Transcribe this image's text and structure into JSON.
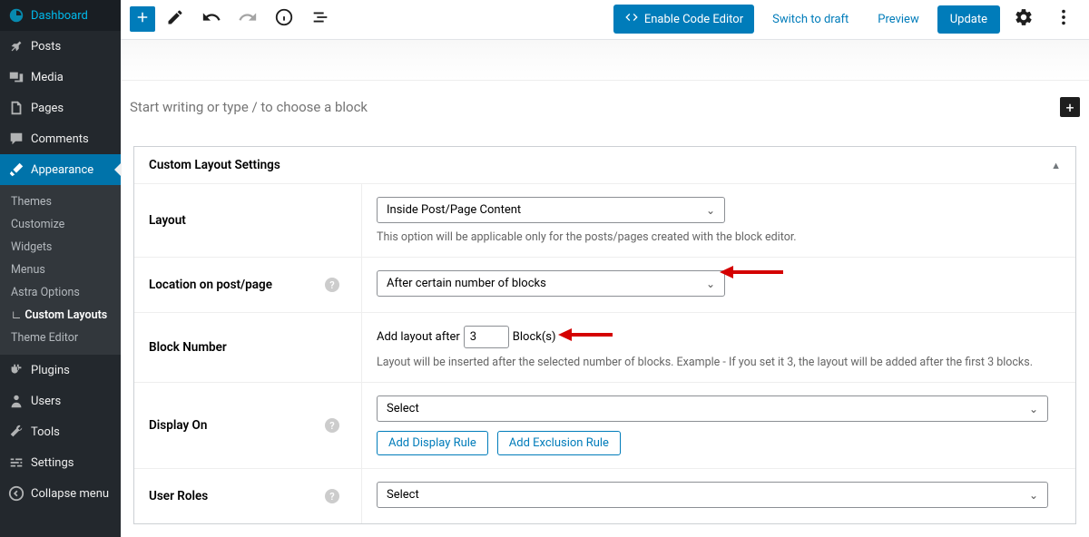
{
  "sidebar": {
    "items": [
      {
        "label": "Dashboard",
        "icon": "dashboard"
      },
      {
        "label": "Posts",
        "icon": "pin"
      },
      {
        "label": "Media",
        "icon": "media"
      },
      {
        "label": "Pages",
        "icon": "pages"
      },
      {
        "label": "Comments",
        "icon": "comment"
      },
      {
        "label": "Appearance",
        "icon": "brush",
        "active": true
      },
      {
        "label": "Plugins",
        "icon": "plug"
      },
      {
        "label": "Users",
        "icon": "user"
      },
      {
        "label": "Tools",
        "icon": "wrench"
      },
      {
        "label": "Settings",
        "icon": "sliders"
      },
      {
        "label": "Collapse menu",
        "icon": "collapse"
      }
    ],
    "sub": [
      {
        "label": "Themes"
      },
      {
        "label": "Customize"
      },
      {
        "label": "Widgets"
      },
      {
        "label": "Menus"
      },
      {
        "label": "Astra Options"
      },
      {
        "label": "Custom Layouts",
        "current": true
      },
      {
        "label": "Theme Editor"
      }
    ]
  },
  "toolbar": {
    "enable_code_editor": "Enable Code Editor",
    "switch_draft": "Switch to draft",
    "preview": "Preview",
    "update": "Update"
  },
  "editor": {
    "placeholder": "Start writing or type / to choose a block"
  },
  "panel": {
    "title": "Custom Layout Settings",
    "rows": {
      "layout": {
        "label": "Layout",
        "value": "Inside Post/Page Content",
        "help": "This option will be applicable only for the posts/pages created with the block editor."
      },
      "location": {
        "label": "Location on post/page",
        "value": "After certain number of blocks"
      },
      "block_number": {
        "label": "Block Number",
        "prefix": "Add layout after",
        "value": "3",
        "suffix": "Block(s)",
        "help": "Layout will be inserted after the selected number of blocks. Example - If you set it 3, the layout will be added after the first 3 blocks."
      },
      "display_on": {
        "label": "Display On",
        "value": "Select",
        "add_display": "Add Display Rule",
        "add_exclusion": "Add Exclusion Rule"
      },
      "user_roles": {
        "label": "User Roles",
        "value": "Select"
      }
    }
  }
}
